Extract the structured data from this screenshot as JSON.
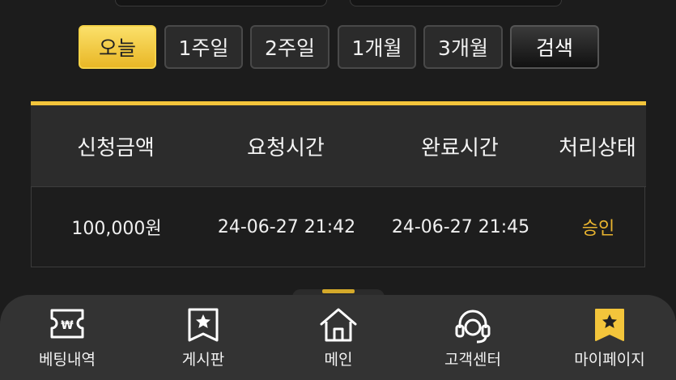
{
  "filters": {
    "today": "오늘",
    "week1": "1주일",
    "week2": "2주일",
    "month1": "1개월",
    "month3": "3개월",
    "search": "검색"
  },
  "table": {
    "headers": [
      "신청금액",
      "요청시간",
      "완료시간",
      "처리상태"
    ],
    "rows": [
      [
        "100,000원",
        "24-06-27 21:42",
        "24-06-27 21:45",
        "승인"
      ]
    ]
  },
  "nav": {
    "items": [
      {
        "label": "베팅내역",
        "icon": "betting-ticket-icon"
      },
      {
        "label": "게시판",
        "icon": "board-icon"
      },
      {
        "label": "메인",
        "icon": "home-icon"
      },
      {
        "label": "고객센터",
        "icon": "headset-icon"
      },
      {
        "label": "마이페이지",
        "icon": "mypage-star-icon"
      }
    ]
  },
  "colors": {
    "accent": "#f3c53b",
    "status_approved": "#e9b42f",
    "background": "#1c1c1c"
  }
}
